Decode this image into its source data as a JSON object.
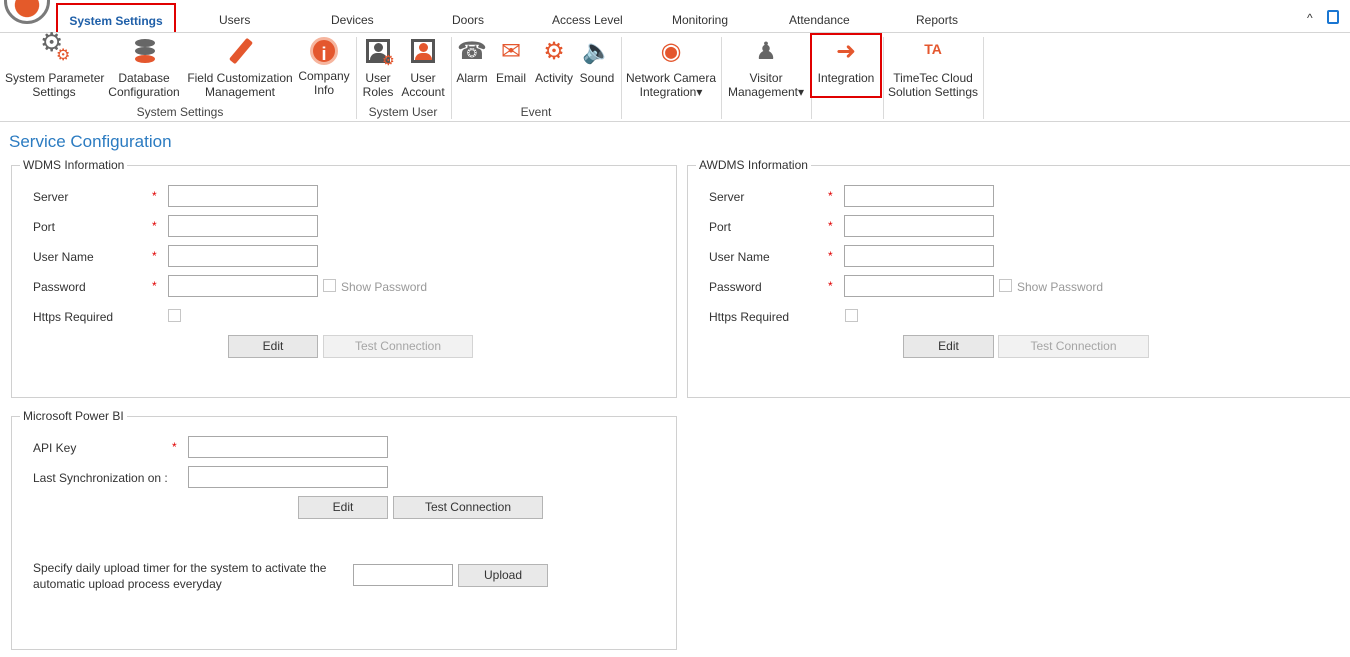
{
  "ribbon_tabs": {
    "active": "System Settings",
    "items": [
      "Users",
      "Devices",
      "Doors",
      "Access Level",
      "Monitoring",
      "Attendance",
      "Reports"
    ],
    "collapse_glyph": "^"
  },
  "ribbon": {
    "system_settings_group": {
      "label": "System Settings",
      "buttons": [
        {
          "label1": "System Parameter",
          "label2": "Settings",
          "icon": "gear-icon"
        },
        {
          "label1": "Database",
          "label2": "Configuration",
          "icon": "database-icon"
        },
        {
          "label1": "Field Customization",
          "label2": "Management",
          "icon": "pencil-icon"
        },
        {
          "label1": "Company",
          "label2": "Info",
          "icon": "info-icon"
        }
      ]
    },
    "system_user_group": {
      "label": "System User",
      "buttons": [
        {
          "label1": "User",
          "label2": "Roles",
          "icon": "user-roles-icon"
        },
        {
          "label1": "User",
          "label2": "Account",
          "icon": "user-account-icon"
        }
      ]
    },
    "event_group": {
      "label": "Event",
      "buttons": [
        {
          "label": "Alarm",
          "icon": "alarm-icon"
        },
        {
          "label": "Email",
          "icon": "email-icon"
        },
        {
          "label": "Activity",
          "icon": "activity-icon"
        },
        {
          "label": "Sound",
          "icon": "sound-icon"
        }
      ]
    },
    "network_camera": {
      "label1": "Network Camera",
      "label2": "Integration",
      "icon": "camera-icon"
    },
    "visitor": {
      "label1": "Visitor",
      "label2": "Management",
      "icon": "visitor-icon"
    },
    "integration": {
      "label": "Integration",
      "icon": "integration-icon"
    },
    "timetec": {
      "label1": "TimeTec Cloud",
      "label2": "Solution Settings",
      "icon": "timetec-icon",
      "logo_text": "TA"
    }
  },
  "page": {
    "title": "Service Configuration"
  },
  "wdms": {
    "legend": "WDMS Information",
    "server_label": "Server",
    "port_label": "Port",
    "username_label": "User Name",
    "password_label": "Password",
    "https_label": "Https Required",
    "show_password_label": "Show Password",
    "server_value": "",
    "port_value": "",
    "username_value": "",
    "password_value": "",
    "edit_label": "Edit",
    "test_label": "Test Connection"
  },
  "awdms": {
    "legend": "AWDMS Information",
    "server_label": "Server",
    "port_label": "Port",
    "username_label": "User Name",
    "password_label": "Password",
    "https_label": "Https Required",
    "show_password_label": "Show Password",
    "server_value": "",
    "port_value": "",
    "username_value": "",
    "password_value": "",
    "edit_label": "Edit",
    "test_label": "Test Connection"
  },
  "powerbi": {
    "legend": "Microsoft Power BI",
    "api_key_label": "API Key",
    "last_sync_label": "Last Synchronization on :",
    "api_key_value": "",
    "last_sync_value": "",
    "edit_label": "Edit",
    "test_label": "Test Connection",
    "upload_desc": "Specify daily upload timer for the system to activate the automatic upload process everyday",
    "upload_timer_value": "",
    "upload_label": "Upload"
  },
  "required_mark": "*",
  "colors": {
    "accent_blue": "#1f5fa8",
    "highlight_red": "#e00000",
    "icon_orange": "#e4572e"
  }
}
